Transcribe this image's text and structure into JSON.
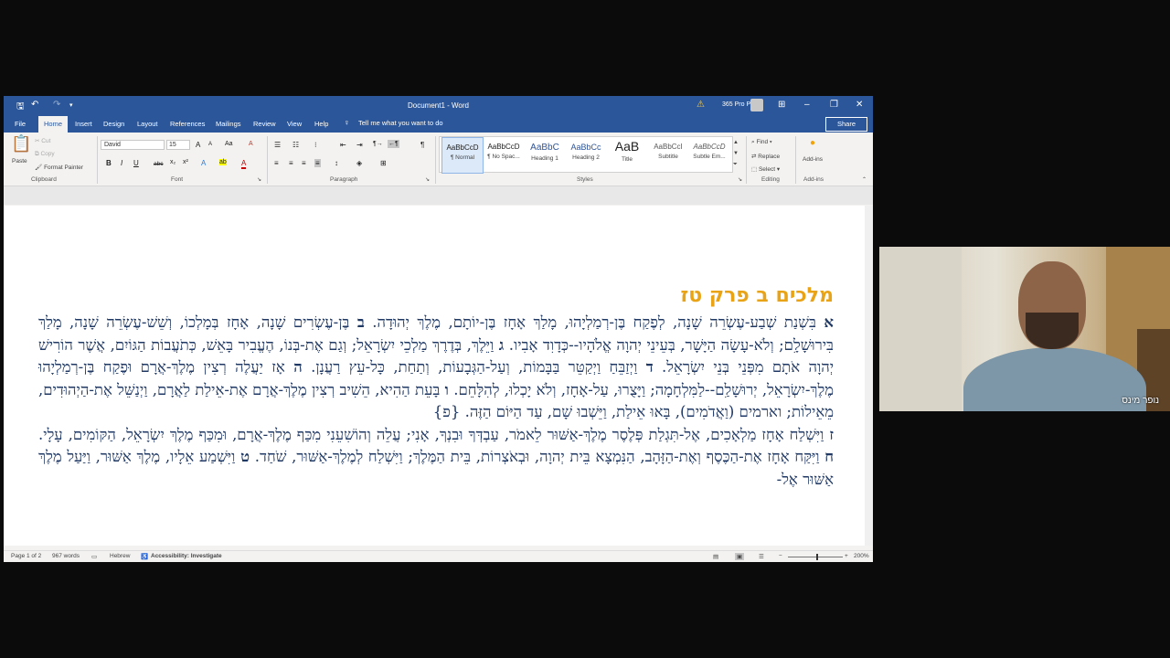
{
  "window": {
    "doc_title": "Document1 - Word",
    "account": "365 Pro Plus",
    "warning_icon": "warning-icon",
    "minimize": "–",
    "restore": "❐",
    "close": "✕",
    "ribbon_display": "⊞"
  },
  "quick_access": {
    "save": "🖫",
    "undo": "↶",
    "redo": "↷",
    "more": "▾"
  },
  "tabs": [
    "File",
    "Home",
    "Insert",
    "Design",
    "Layout",
    "References",
    "Mailings",
    "Review",
    "View",
    "Help"
  ],
  "tell_me": "Tell me what you want to do",
  "share": "Share",
  "ribbon": {
    "clipboard": {
      "paste": "Paste",
      "cut": "Cut",
      "copy": "Copy",
      "format_painter": "Format Painter",
      "label": "Clipboard"
    },
    "font": {
      "name": "David",
      "size": "15",
      "label": "Font",
      "grow": "A",
      "shrink": "A",
      "case": "Aa",
      "clear": "A",
      "bold": "B",
      "italic": "I",
      "underline": "U",
      "strike": "abc",
      "sub": "x₂",
      "sup": "x²",
      "text_effects": "A",
      "highlight": "ab",
      "font_color": "A"
    },
    "paragraph": {
      "label": "Paragraph",
      "bullets": "☰",
      "numbering": "☷",
      "multilevel": "⁝",
      "decrease": "⇤",
      "increase": "⇥",
      "ltr": "¶→",
      "rtl": "←¶",
      "pilcrow": "¶",
      "align_left": "≡",
      "center": "≡",
      "align_right": "≡",
      "justify": "≡",
      "spacing": "↕",
      "shading": "◈",
      "borders": "⊞"
    },
    "styles": {
      "label": "Styles",
      "items": [
        {
          "preview": "AaBbCcD",
          "name": "¶ Normal"
        },
        {
          "preview": "AaBbCcD",
          "name": "¶ No Spac..."
        },
        {
          "preview": "AaBbC",
          "name": "Heading 1"
        },
        {
          "preview": "AaBbCc",
          "name": "Heading 2"
        },
        {
          "preview": "AaB",
          "name": "Title"
        },
        {
          "preview": "AaBbCcI",
          "name": "Subtitle"
        },
        {
          "preview": "AaBbCcD",
          "name": "Subtle Em..."
        }
      ]
    },
    "editing": {
      "find": "Find",
      "replace": "Replace",
      "select": "Select",
      "label": "Editing"
    },
    "addins": {
      "addins": "Add-ins",
      "label": "Add-ins"
    }
  },
  "document": {
    "heading": "מלכים ב פרק טז",
    "verses": [
      {
        "n": "א",
        "t": "בִּשְׁנַת שְׁבַע-עֶשְׂרֵה שָׁנָה, לְפֶקַח בֶּן-רְמַלְיָהוּ, מָלַךְ אָחָז בֶּן-יוֹתָם, מֶלֶךְ יְהוּדָה."
      },
      {
        "n": "ב",
        "t": "בֶּן-עֶשְׂרִים שָׁנָה, אָחָז בְּמָלְכוֹ, וְשֵׁשׁ-עֶשְׂרֵה שָׁנָה, מָלַךְ בִּירוּשָׁלִָם; וְלֹא-עָשָׂה הַיָּשָׁר, בְּעֵינֵי יְהוָה אֱלֹהָיו--כְּדָוִד אָבִיו."
      },
      {
        "n": "ג",
        "t": "וַיֵּלֶךְ, בְּדֶרֶךְ מַלְכֵי יִשְׂרָאֵל; וְגַם אֶת-בְּנוֹ, הֶעֱבִיר בָּאֵשׁ, כְּתֹעֲבוֹת הַגּוֹיִם, אֲשֶׁר הוֹרִישׁ יְהוָה אֹתָם מִפְּנֵי בְּנֵי יִשְׂרָאֵל."
      },
      {
        "n": "ד",
        "t": "וַיְזַבֵּחַ וַיְקַטֵּר בַּבָּמוֹת, וְעַל-הַגְּבָעוֹת, וְתַחַת, כָּל-עֵץ רַעֲנָן."
      },
      {
        "n": "ה",
        "t": "אָז יַעֲלֶה רְצִין מֶלֶךְ-אֲרָם וּפֶקַח בֶּן-רְמַלְיָהוּ מֶלֶךְ-יִשְׂרָאֵל, יְרוּשָׁלִַם--לַמִּלְחָמָה; וַיָּצֻרוּ, עַל-אָחָז, וְלֹא יָכְלוּ, לְהִלָּחֵם."
      },
      {
        "n": "ו",
        "t": "בָּעֵת הַהִיא, הֵשִׁיב רְצִין מֶלֶךְ-אֲרָם אֶת-אֵילַת לַאֲרָם, וַיְנַשֵּׁל אֶת-הַיְהוּדִים, מֵאֵילוֹת; וארמים (וַאֲדֹמִים), בָּאוּ אֵילַת, וַיֵּשְׁבוּ שָׁם, עַד הַיּוֹם הַזֶּה. {פ}"
      },
      {
        "n": "ז",
        "t": "וַיִּשְׁלַח אָחָז מַלְאָכִים, אֶל-תִּגְלַת פְּלֶסֶר מֶלֶךְ-אַשּׁוּר לֵאמֹר, עַבְדְּךָ וּבִנְךָ, אָנִי; עֲלֵה וְהוֹשִׁעֵנִי מִכַּף מֶלֶךְ-אֲרָם, וּמִכַּף מֶלֶךְ יִשְׂרָאֵל, הַקּוֹמִים, עָלָי."
      },
      {
        "n": "ח",
        "t": "וַיִּקַּח אָחָז אֶת-הַכֶּסֶף וְאֶת-הַזָּהָב, הַנִּמְצָא בֵּית יְהוָה, וּבְאֹצְרוֹת, בֵּית הַמֶּלֶךְ; וַיִּשְׁלַח לְמֶלֶךְ-אַשּׁוּר, שֹׁחַד."
      },
      {
        "n": "ט",
        "t": "וַיִּשְׁמַע אֵלָיו, מֶלֶךְ אַשּׁוּר, וַיַּעַל מֶלֶךְ אַשּׁוּר אֶל-"
      }
    ]
  },
  "status": {
    "page": "Page 1 of 2",
    "words": "967 words",
    "language": "Hebrew",
    "accessibility": "Accessibility: Investigate",
    "zoom": "200%"
  },
  "video": {
    "name": "נופר מינס"
  }
}
